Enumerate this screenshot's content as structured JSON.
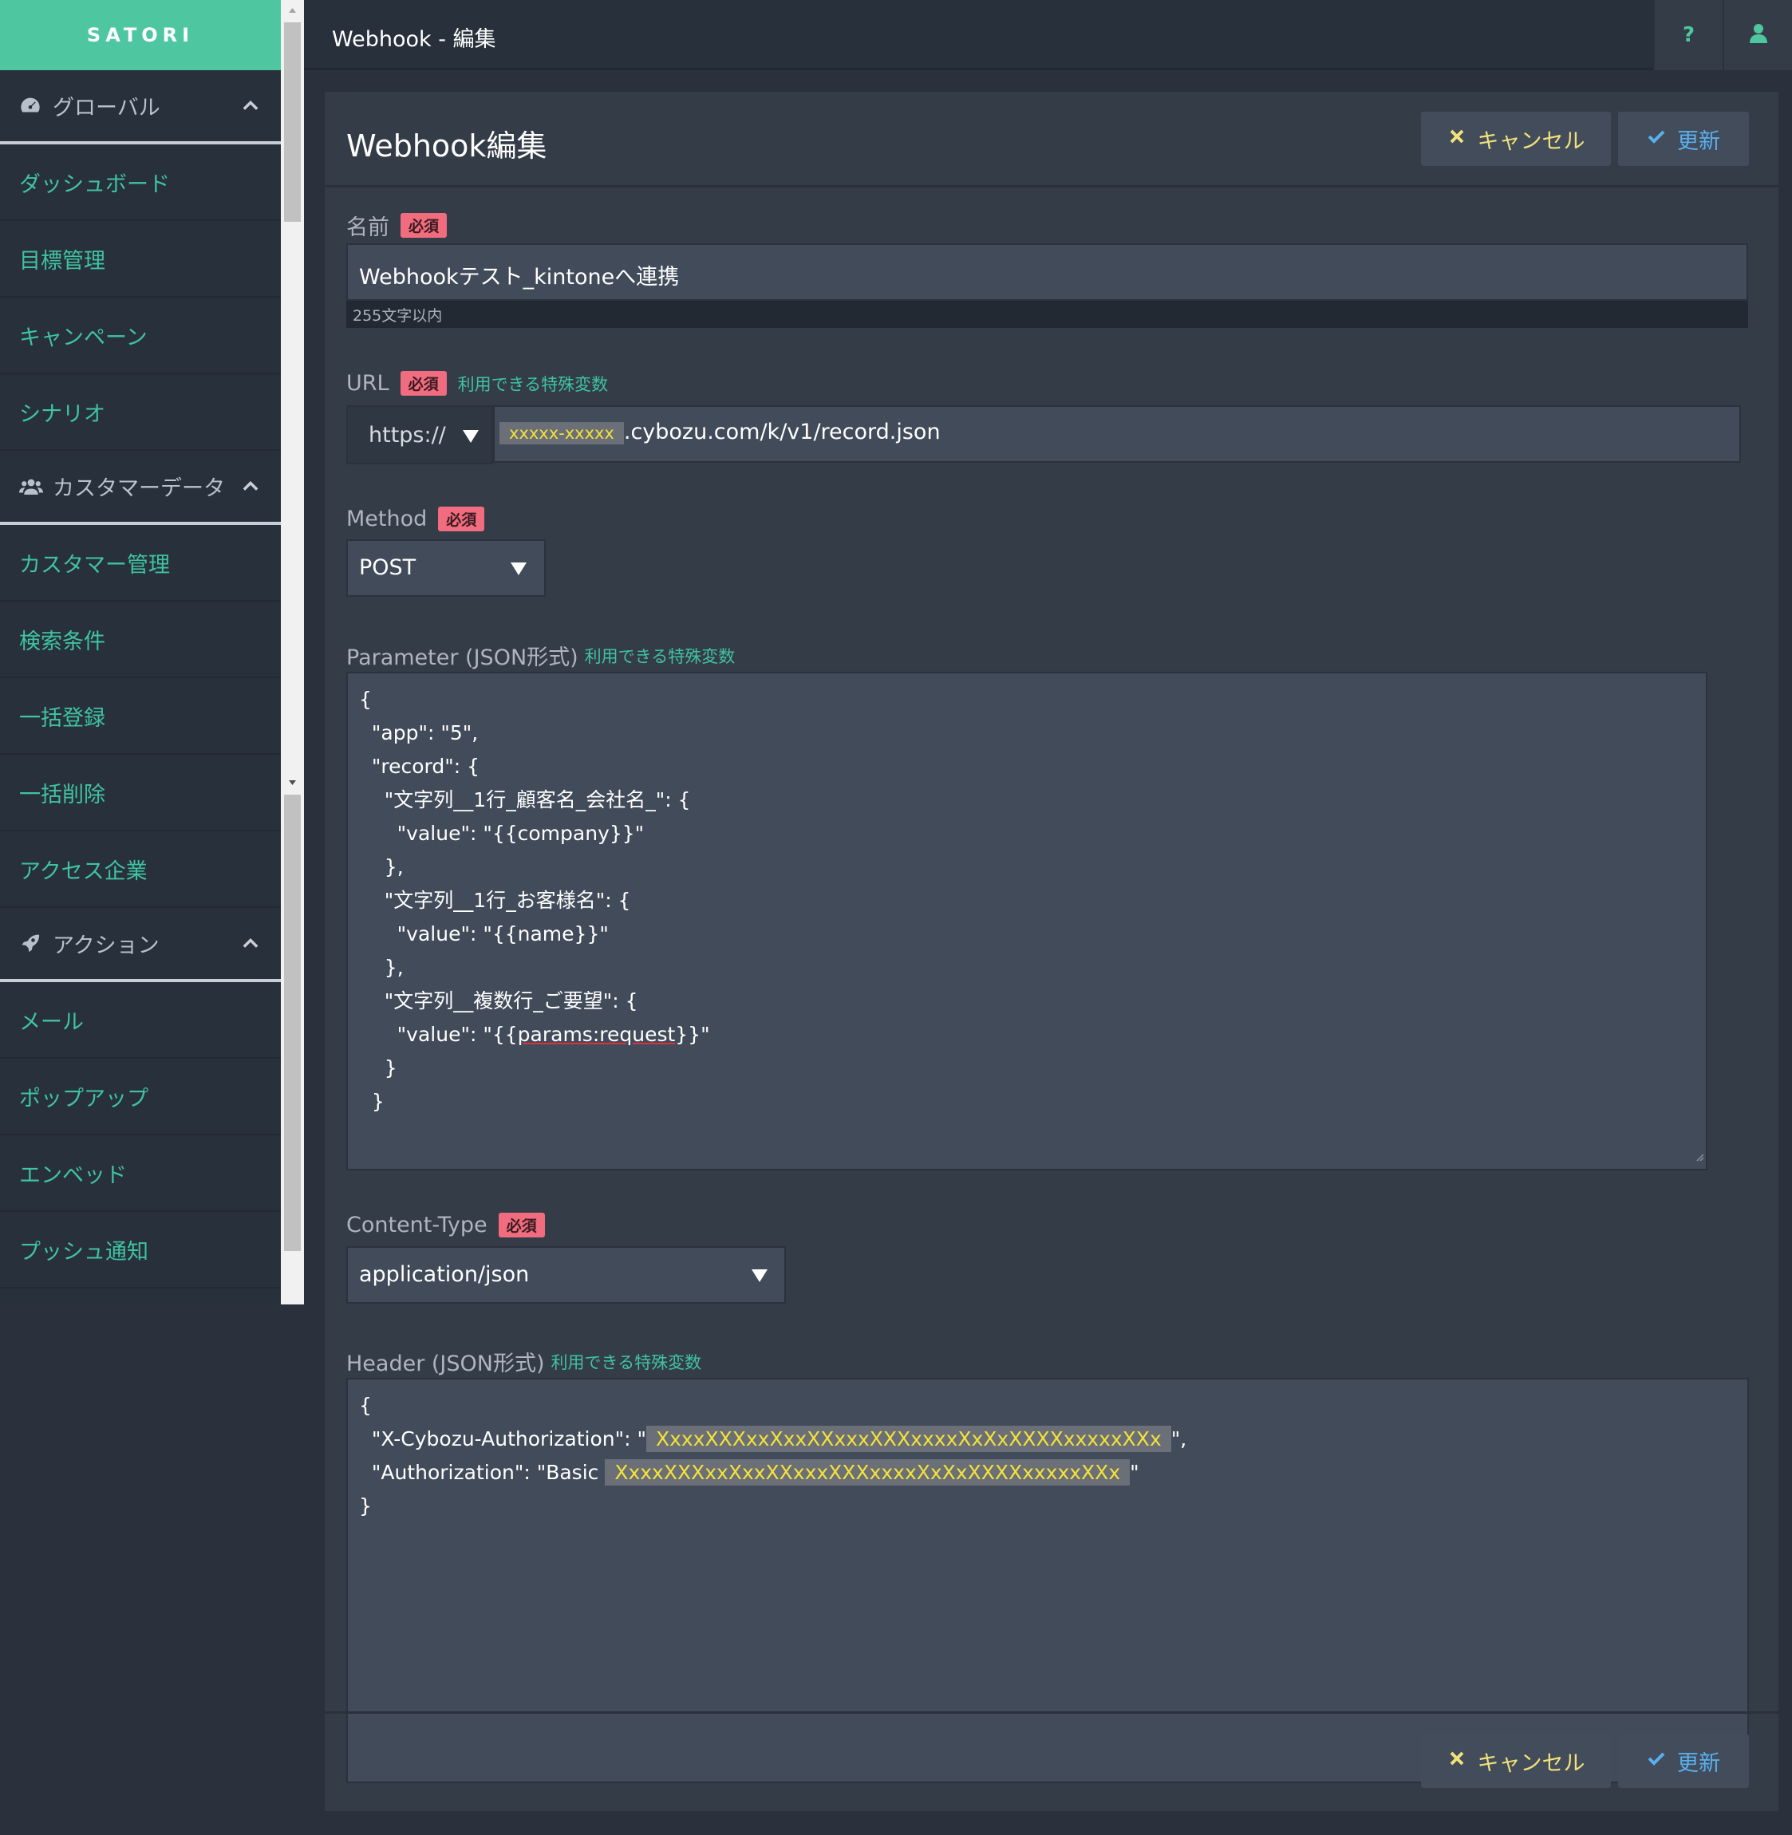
{
  "sidebar": {
    "logo": "SATORI",
    "sections": [
      {
        "label": "グローバル",
        "icon": "dashboard-gauge-icon",
        "items": [
          "ダッシュボード",
          "目標管理",
          "キャンペーン",
          "シナリオ"
        ]
      },
      {
        "label": "カスタマーデータ",
        "icon": "users-icon",
        "items": [
          "カスタマー管理",
          "検索条件",
          "一括登録",
          "一括削除",
          "アクセス企業"
        ]
      },
      {
        "label": "アクション",
        "icon": "rocket-icon",
        "items": [
          "メール",
          "ポップアップ",
          "エンベッド",
          "プッシュ通知"
        ]
      }
    ]
  },
  "topbar": {
    "title": "Webhook - 編集",
    "help_label": "?"
  },
  "panel": {
    "title": "Webhook編集",
    "cancel_label": "キャンセル",
    "update_label": "更新"
  },
  "form": {
    "required_badge": "必須",
    "variables_link": "利用できる特殊変数",
    "name": {
      "label": "名前",
      "value": "Webhookテスト_kintoneへ連携",
      "help": "255文字以内"
    },
    "url": {
      "label": "URL",
      "protocol": "https://",
      "masked_subdomain": "xxxxx-xxxxx",
      "path": ".cybozu.com/k/v1/record.json"
    },
    "method": {
      "label": "Method",
      "value": "POST"
    },
    "parameter": {
      "label": "Parameter (JSON形式)",
      "lines": [
        "{",
        "  \"app\": \"5\",",
        "  \"record\": {",
        "    \"文字列__1行_顧客名_会社名_\": {",
        "      \"value\": \"{{company}}\"",
        "    },",
        "    \"文字列__1行_お客様名\": {",
        "      \"value\": \"{{name}}\"",
        "    },",
        "    \"文字列__複数行_ご要望\": {"
      ],
      "line_request_prefix": "      \"value\": \"{{",
      "line_request_var": "params:request",
      "line_request_suffix": "}}\"",
      "closing_lines": [
        "    }",
        "  }"
      ]
    },
    "content_type": {
      "label": "Content-Type",
      "value": "application/json"
    },
    "header": {
      "label": "Header (JSON形式)",
      "open": "{",
      "line1_prefix": "  \"X-Cybozu-Authorization\": \"",
      "line1_masked": "XxxxXXXxxXxxXXxxxXXXxxxxXxXxXXXXxxxxxXXx",
      "line1_suffix": "\",",
      "line2_prefix": "  \"Authorization\": \"Basic",
      "line2_masked": "XxxxXXXxxXxxXXxxxXXXxxxxXxXxXXXXxxxxxXXx",
      "line2_suffix": "\"",
      "close": "}"
    }
  },
  "colors": {
    "accent": "#4ec7a0",
    "background": "#2a313c",
    "panel": "#343c48",
    "field": "#414b5a",
    "required": "#f06c7e",
    "cancel": "#f1e27a",
    "update": "#5ab0ee"
  }
}
